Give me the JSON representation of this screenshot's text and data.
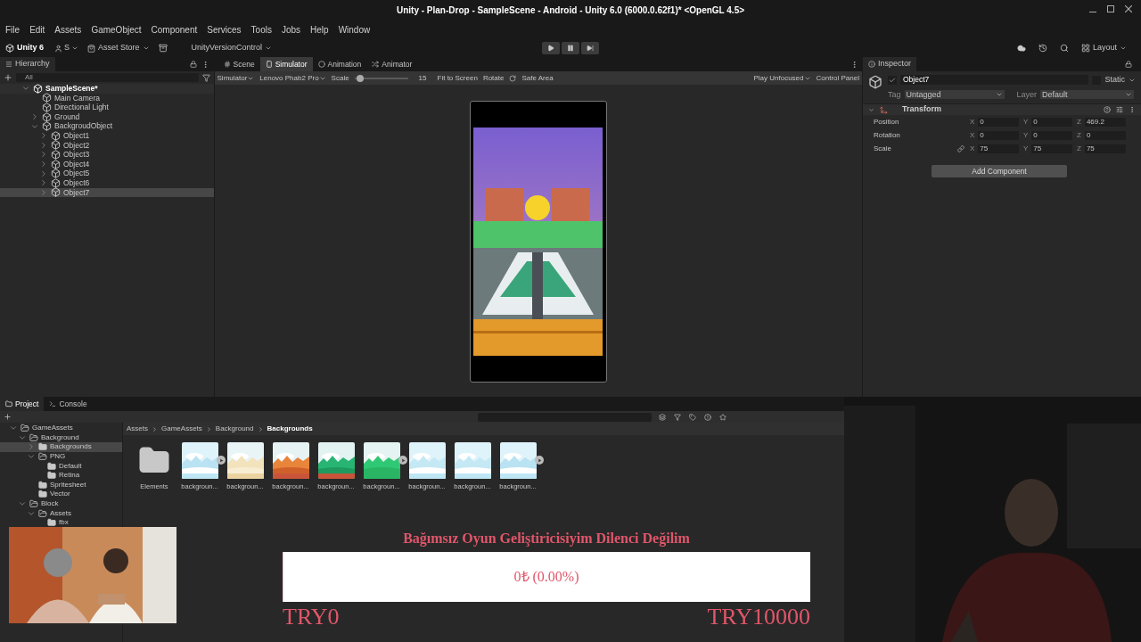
{
  "window": {
    "title": "Unity - Plan-Drop - SampleScene - Android - Unity 6.0 (6000.0.62f1)* <OpenGL 4.5>"
  },
  "menu": [
    "File",
    "Edit",
    "Assets",
    "GameObject",
    "Component",
    "Services",
    "Tools",
    "Jobs",
    "Help",
    "Window"
  ],
  "toolbar": {
    "account": "Unity 6",
    "user": "S",
    "asset_store": "Asset Store",
    "version_control": "UnityVersionControl",
    "layout": "Layout"
  },
  "hierarchy": {
    "tab": "Hierarchy",
    "search_placeholder": "All",
    "tree": [
      {
        "label": "SampleScene*",
        "kind": "scene",
        "expanded": true,
        "selected": false,
        "children": [
          {
            "label": "Main Camera",
            "kind": "object",
            "selected": false
          },
          {
            "label": "Directional Light",
            "kind": "object",
            "selected": false
          },
          {
            "label": "Ground",
            "kind": "object",
            "expanded": false,
            "selected": false
          },
          {
            "label": "BackgroudObject",
            "kind": "object",
            "expanded": true,
            "selected": false,
            "children": [
              {
                "label": "Object1",
                "kind": "object",
                "expanded": false,
                "selected": false
              },
              {
                "label": "Object2",
                "kind": "object",
                "expanded": false,
                "selected": false
              },
              {
                "label": "Object3",
                "kind": "object",
                "expanded": false,
                "selected": false
              },
              {
                "label": "Object4",
                "kind": "object",
                "expanded": false,
                "selected": false
              },
              {
                "label": "Object5",
                "kind": "object",
                "expanded": false,
                "selected": false
              },
              {
                "label": "Object6",
                "kind": "object",
                "expanded": false,
                "selected": false
              },
              {
                "label": "Object7",
                "kind": "object",
                "expanded": false,
                "selected": true
              }
            ]
          }
        ]
      }
    ]
  },
  "view_tabs": [
    {
      "label": "Scene",
      "kind": "scene",
      "selected": false
    },
    {
      "label": "Simulator",
      "kind": "simulator",
      "selected": true
    },
    {
      "label": "Animation",
      "kind": "animation",
      "selected": false
    },
    {
      "label": "Animator",
      "kind": "animator",
      "selected": false
    }
  ],
  "simulator": {
    "mode": "Simulator",
    "device": "Lenovo Phab2 Pro",
    "scale_label": "Scale",
    "level": 0.1,
    "scale_value": "15",
    "fit": "Fit to Screen",
    "rotate": "Rotate",
    "safe_area": "Safe Area",
    "play_mode": "Play Unfocused",
    "control_panel": "Control Panel"
  },
  "inspector": {
    "tab": "Inspector",
    "object_name": "Object7",
    "active": true,
    "static": false,
    "static_label": "Static",
    "tag_label": "Tag",
    "tag": "Untagged",
    "layer_label": "Layer",
    "layer": "Default",
    "component": "Transform",
    "rows": [
      {
        "label": "Position",
        "linked": false,
        "fields": [
          {
            "axis": "X",
            "value": "0"
          },
          {
            "axis": "Y",
            "value": "0"
          },
          {
            "axis": "Z",
            "value": "469.2"
          }
        ]
      },
      {
        "label": "Rotation",
        "linked": false,
        "fields": [
          {
            "axis": "X",
            "value": "0"
          },
          {
            "axis": "Y",
            "value": "0"
          },
          {
            "axis": "Z",
            "value": "0"
          }
        ]
      },
      {
        "label": "Scale",
        "linked": true,
        "fields": [
          {
            "axis": "X",
            "value": "75"
          },
          {
            "axis": "Y",
            "value": "75"
          },
          {
            "axis": "Z",
            "value": "75"
          }
        ]
      }
    ],
    "add_component": "Add Component"
  },
  "project": {
    "tabs": [
      {
        "label": "Project",
        "kind": "project",
        "selected": true
      },
      {
        "label": "Console",
        "kind": "console",
        "selected": false
      }
    ],
    "tree": [
      {
        "label": "GameAssets",
        "expanded": true,
        "selected": false,
        "children": [
          {
            "label": "Background",
            "expanded": true,
            "selected": false,
            "children": [
              {
                "label": "Backgrounds",
                "expanded": false,
                "selected": true
              },
              {
                "label": "PNG",
                "expanded": true,
                "selected": false,
                "children": [
                  {
                    "label": "Default",
                    "selected": false
                  },
                  {
                    "label": "Retina",
                    "selected": false
                  }
                ]
              },
              {
                "label": "Spritesheet",
                "selected": false
              },
              {
                "label": "Vector",
                "selected": false
              }
            ]
          },
          {
            "label": "Block",
            "expanded": true,
            "selected": false,
            "children": [
              {
                "label": "Assets",
                "expanded": true,
                "selected": false,
                "children": [
                  {
                    "label": "fbx",
                    "selected": false
                  }
                ]
              }
            ]
          }
        ]
      }
    ],
    "breadcrumb": [
      "Assets",
      "GameAssets",
      "Background",
      "Backgrounds"
    ],
    "assets": [
      {
        "label": "Elements",
        "kind": "folder",
        "sub_assets": false
      },
      {
        "label": "backgroun...",
        "kind": "picture",
        "sub_assets": true
      },
      {
        "label": "backgroun...",
        "kind": "picture",
        "sub_assets": false
      },
      {
        "label": "backgroun...",
        "kind": "picture",
        "sub_assets": false
      },
      {
        "label": "backgroun...",
        "kind": "picture",
        "sub_assets": false
      },
      {
        "label": "backgroun...",
        "kind": "picture",
        "sub_assets": true
      },
      {
        "label": "backgroun...",
        "kind": "picture",
        "sub_assets": false
      },
      {
        "label": "backgroun...",
        "kind": "picture",
        "sub_assets": false
      },
      {
        "label": "backgroun...",
        "kind": "picture",
        "sub_assets": true
      }
    ]
  },
  "donation": {
    "title": "Bağımsız Oyun Geliştiricisiyim Dilenci Değilim",
    "amount": "0₺ (0.00%)",
    "level": 0,
    "min": "TRY0",
    "max": "TRY10000"
  }
}
